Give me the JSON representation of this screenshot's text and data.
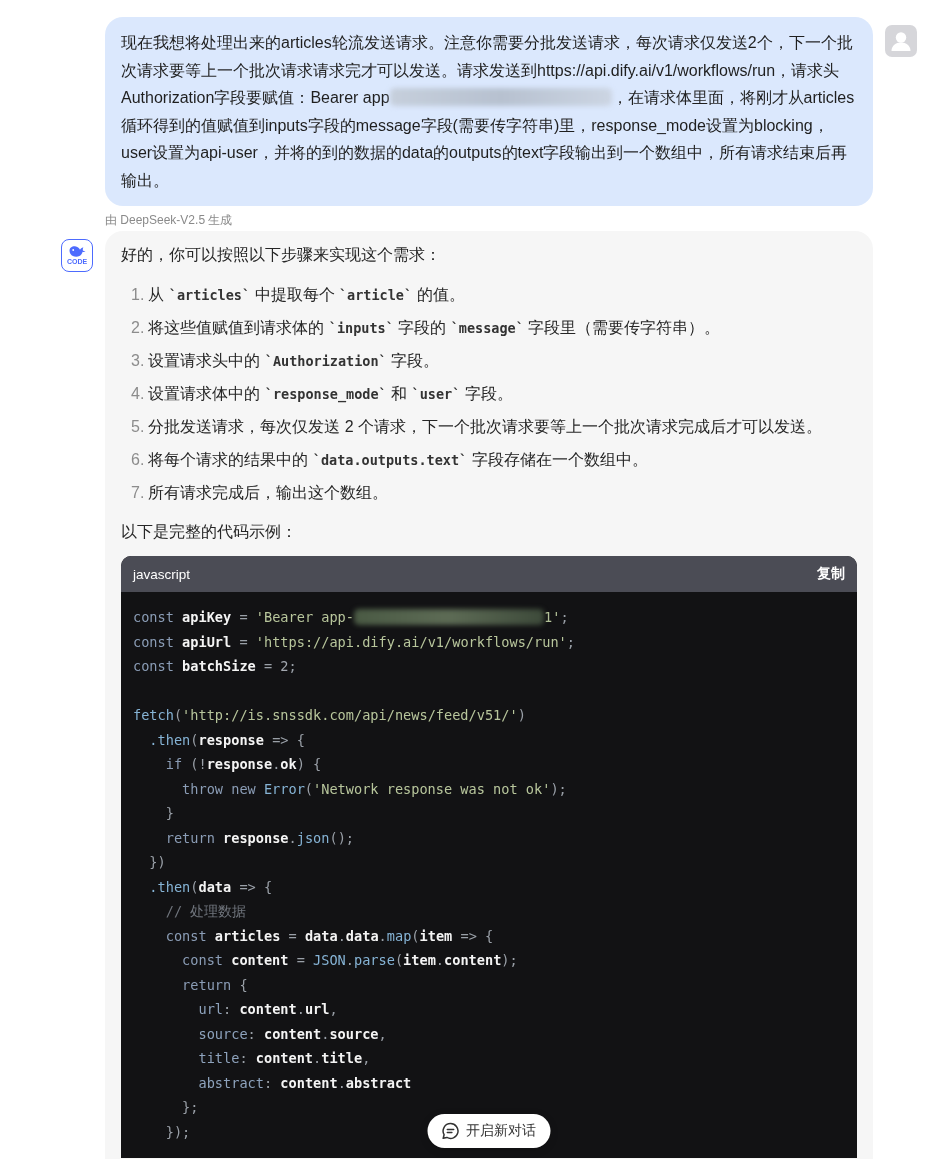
{
  "user_message": {
    "parts": [
      {
        "kind": "text",
        "text": "现在我想将处理出来的articles轮流发送请求。注意你需要分批发送请求，每次请求仅发送2个，下一个批次请求要等上一个批次请求请求完才可以发送。请求发送到https://api.dify.ai/v1/workflows/run，请求头Authorization字段要赋值：Bearer app"
      },
      {
        "kind": "redacted"
      },
      {
        "kind": "text",
        "text": "，在请求体里面，将刚才从articles循环得到的值赋值到inputs字段的message字段(需要传字符串)里，response_mode设置为blocking，user设置为api-user，并将的到的数据的data的outputs的text字段输出到一个数组中，所有请求结束后再输出。"
      }
    ]
  },
  "model_caption": "由 DeepSeek-V2.5 生成",
  "bot_message": {
    "avatar_label": "CODE",
    "intro": "好的，你可以按照以下步骤来实现这个需求：",
    "steps": [
      {
        "number": "1.",
        "segments": [
          {
            "kind": "text",
            "text": "从 "
          },
          {
            "kind": "code",
            "text": "`articles`"
          },
          {
            "kind": "text",
            "text": " 中提取每个 "
          },
          {
            "kind": "code",
            "text": "`article`"
          },
          {
            "kind": "text",
            "text": " 的值。"
          }
        ]
      },
      {
        "number": "2.",
        "segments": [
          {
            "kind": "text",
            "text": "将这些值赋值到请求体的 "
          },
          {
            "kind": "code",
            "text": "`inputs`"
          },
          {
            "kind": "text",
            "text": " 字段的 "
          },
          {
            "kind": "code",
            "text": "`message`"
          },
          {
            "kind": "text",
            "text": " 字段里（需要传字符串）。"
          }
        ]
      },
      {
        "number": "3.",
        "segments": [
          {
            "kind": "text",
            "text": "设置请求头中的 "
          },
          {
            "kind": "code",
            "text": "`Authorization`"
          },
          {
            "kind": "text",
            "text": " 字段。"
          }
        ]
      },
      {
        "number": "4.",
        "segments": [
          {
            "kind": "text",
            "text": "设置请求体中的 "
          },
          {
            "kind": "code",
            "text": "`response_mode`"
          },
          {
            "kind": "text",
            "text": " 和 "
          },
          {
            "kind": "code",
            "text": "`user`"
          },
          {
            "kind": "text",
            "text": " 字段。"
          }
        ]
      },
      {
        "number": "5.",
        "segments": [
          {
            "kind": "text",
            "text": "分批发送请求，每次仅发送 2 个请求，下一个批次请求要等上一个批次请求完成后才可以发送。"
          }
        ]
      },
      {
        "number": "6.",
        "segments": [
          {
            "kind": "text",
            "text": "将每个请求的结果中的 "
          },
          {
            "kind": "code",
            "text": "`data.outputs.text`"
          },
          {
            "kind": "text",
            "text": " 字段存储在一个数组中。"
          }
        ]
      },
      {
        "number": "7.",
        "segments": [
          {
            "kind": "text",
            "text": "所有请求完成后，输出这个数组。"
          }
        ]
      }
    ],
    "outro": "以下是完整的代码示例：",
    "code_block": {
      "language": "javascript",
      "copy_label": "复制",
      "sections": [
        {
          "lines": [
            {
              "tokens": [
                {
                  "kind": "keyword",
                  "text": "const "
                },
                {
                  "kind": "name",
                  "text": "apiKey"
                },
                {
                  "kind": "punct",
                  "text": " = "
                },
                {
                  "kind": "string",
                  "text": "'Bearer app-"
                },
                {
                  "kind": "redacted"
                },
                {
                  "kind": "string",
                  "text": "1'"
                },
                {
                  "kind": "punct",
                  "text": ";"
                }
              ]
            },
            {
              "tokens": [
                {
                  "kind": "keyword",
                  "text": "const "
                },
                {
                  "kind": "name",
                  "text": "apiUrl"
                },
                {
                  "kind": "punct",
                  "text": " = "
                },
                {
                  "kind": "string",
                  "text": "'https://api.dify.ai/v1/workflows/run'"
                },
                {
                  "kind": "punct",
                  "text": ";"
                }
              ]
            },
            {
              "tokens": [
                {
                  "kind": "keyword",
                  "text": "const "
                },
                {
                  "kind": "name",
                  "text": "batchSize"
                },
                {
                  "kind": "punct",
                  "text": " = "
                },
                {
                  "kind": "number",
                  "text": "2"
                },
                {
                  "kind": "punct",
                  "text": ";"
                }
              ]
            }
          ]
        },
        {
          "lines": [
            {
              "tokens": [
                {
                  "kind": "call",
                  "text": "fetch"
                },
                {
                  "kind": "punct",
                  "text": "("
                },
                {
                  "kind": "string",
                  "text": "'http://is.snssdk.com/api/news/feed/v51/'"
                },
                {
                  "kind": "punct",
                  "text": ")"
                }
              ],
              "children": [
                {
                  "tokens": [
                    {
                      "kind": "call",
                      "text": ".then"
                    },
                    {
                      "kind": "punct",
                      "text": "("
                    },
                    {
                      "kind": "name",
                      "text": "response"
                    },
                    {
                      "kind": "punct",
                      "text": " => {"
                    }
                  ],
                  "children": [
                    {
                      "tokens": [
                        {
                          "kind": "keyword",
                          "text": "if"
                        },
                        {
                          "kind": "punct",
                          "text": " (!"
                        },
                        {
                          "kind": "name",
                          "text": "response"
                        },
                        {
                          "kind": "punct",
                          "text": "."
                        },
                        {
                          "kind": "name",
                          "text": "ok"
                        },
                        {
                          "kind": "punct",
                          "text": ") {"
                        }
                      ],
                      "children": [
                        {
                          "tokens": [
                            {
                              "kind": "keyword",
                              "text": "throw new "
                            },
                            {
                              "kind": "call",
                              "text": "Error"
                            },
                            {
                              "kind": "punct",
                              "text": "("
                            },
                            {
                              "kind": "string",
                              "text": "'Network response was not ok'"
                            },
                            {
                              "kind": "punct",
                              "text": ");"
                            }
                          ]
                        }
                      ]
                    },
                    {
                      "tokens": [
                        {
                          "kind": "punct",
                          "text": "}"
                        }
                      ]
                    },
                    {
                      "tokens": [
                        {
                          "kind": "keyword",
                          "text": "return "
                        },
                        {
                          "kind": "name",
                          "text": "response"
                        },
                        {
                          "kind": "punct",
                          "text": "."
                        },
                        {
                          "kind": "call",
                          "text": "json"
                        },
                        {
                          "kind": "punct",
                          "text": "();"
                        }
                      ]
                    }
                  ]
                },
                {
                  "tokens": [
                    {
                      "kind": "punct",
                      "text": "})"
                    }
                  ]
                },
                {
                  "tokens": [
                    {
                      "kind": "call",
                      "text": ".then"
                    },
                    {
                      "kind": "punct",
                      "text": "("
                    },
                    {
                      "kind": "name",
                      "text": "data"
                    },
                    {
                      "kind": "punct",
                      "text": " => {"
                    }
                  ],
                  "children": [
                    {
                      "tokens": [
                        {
                          "kind": "comment",
                          "text": "// 处理数据"
                        }
                      ]
                    },
                    {
                      "tokens": [
                        {
                          "kind": "keyword",
                          "text": "const "
                        },
                        {
                          "kind": "name",
                          "text": "articles"
                        },
                        {
                          "kind": "punct",
                          "text": " = "
                        },
                        {
                          "kind": "name",
                          "text": "data"
                        },
                        {
                          "kind": "punct",
                          "text": "."
                        },
                        {
                          "kind": "name",
                          "text": "data"
                        },
                        {
                          "kind": "punct",
                          "text": "."
                        },
                        {
                          "kind": "call",
                          "text": "map"
                        },
                        {
                          "kind": "punct",
                          "text": "("
                        },
                        {
                          "kind": "name",
                          "text": "item"
                        },
                        {
                          "kind": "punct",
                          "text": " => {"
                        }
                      ],
                      "children": [
                        {
                          "tokens": [
                            {
                              "kind": "keyword",
                              "text": "const "
                            },
                            {
                              "kind": "name",
                              "text": "content"
                            },
                            {
                              "kind": "punct",
                              "text": " = "
                            },
                            {
                              "kind": "call",
                              "text": "JSON"
                            },
                            {
                              "kind": "punct",
                              "text": "."
                            },
                            {
                              "kind": "call",
                              "text": "parse"
                            },
                            {
                              "kind": "punct",
                              "text": "("
                            },
                            {
                              "kind": "name",
                              "text": "item"
                            },
                            {
                              "kind": "punct",
                              "text": "."
                            },
                            {
                              "kind": "name",
                              "text": "content"
                            },
                            {
                              "kind": "punct",
                              "text": ");"
                            }
                          ]
                        },
                        {
                          "tokens": [
                            {
                              "kind": "keyword",
                              "text": "return "
                            },
                            {
                              "kind": "punct",
                              "text": "{"
                            }
                          ],
                          "children": [
                            {
                              "tokens": [
                                {
                                  "kind": "property",
                                  "text": "url"
                                },
                                {
                                  "kind": "punct",
                                  "text": ": "
                                },
                                {
                                  "kind": "name",
                                  "text": "content"
                                },
                                {
                                  "kind": "punct",
                                  "text": "."
                                },
                                {
                                  "kind": "name",
                                  "text": "url"
                                },
                                {
                                  "kind": "punct",
                                  "text": ","
                                }
                              ]
                            },
                            {
                              "tokens": [
                                {
                                  "kind": "property",
                                  "text": "source"
                                },
                                {
                                  "kind": "punct",
                                  "text": ": "
                                },
                                {
                                  "kind": "name",
                                  "text": "content"
                                },
                                {
                                  "kind": "punct",
                                  "text": "."
                                },
                                {
                                  "kind": "name",
                                  "text": "source"
                                },
                                {
                                  "kind": "punct",
                                  "text": ","
                                }
                              ]
                            },
                            {
                              "tokens": [
                                {
                                  "kind": "property",
                                  "text": "title"
                                },
                                {
                                  "kind": "punct",
                                  "text": ": "
                                },
                                {
                                  "kind": "name",
                                  "text": "content"
                                },
                                {
                                  "kind": "punct",
                                  "text": "."
                                },
                                {
                                  "kind": "name",
                                  "text": "title"
                                },
                                {
                                  "kind": "punct",
                                  "text": ","
                                }
                              ]
                            },
                            {
                              "tokens": [
                                {
                                  "kind": "property",
                                  "text": "abstract"
                                },
                                {
                                  "kind": "punct",
                                  "text": ": "
                                },
                                {
                                  "kind": "name",
                                  "text": "content"
                                },
                                {
                                  "kind": "punct",
                                  "text": "."
                                },
                                {
                                  "kind": "name",
                                  "text": "abstract"
                                }
                              ]
                            }
                          ]
                        },
                        {
                          "tokens": [
                            {
                              "kind": "punct",
                              "text": "};"
                            }
                          ]
                        }
                      ]
                    },
                    {
                      "tokens": [
                        {
                          "kind": "punct",
                          "text": "});"
                        }
                      ]
                    }
                  ]
                }
              ]
            }
          ]
        }
      ]
    }
  },
  "new_chat_button": {
    "label": "开启新对话"
  }
}
